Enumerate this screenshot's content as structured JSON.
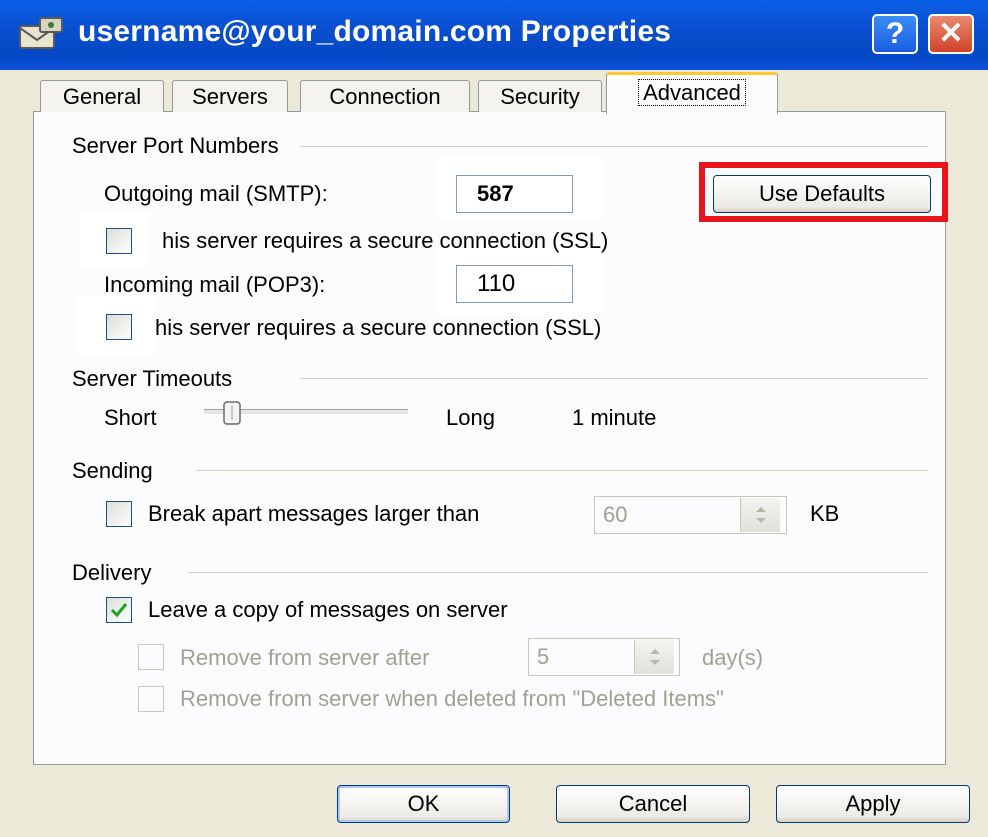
{
  "window": {
    "title": "username@your_domain.com Properties",
    "help_glyph": "?",
    "close_glyph": "✕"
  },
  "tabs": [
    {
      "label": "General"
    },
    {
      "label": "Servers"
    },
    {
      "label": "Connection"
    },
    {
      "label": "Security"
    },
    {
      "label": "Advanced",
      "active": true
    }
  ],
  "ports": {
    "group_label": "Server Port Numbers",
    "smtp_label": "Outgoing mail (SMTP):",
    "smtp_value": "587",
    "defaults_button": "Use Defaults",
    "smtp_ssl_label": "his server requires a secure connection (SSL)",
    "pop3_label": "Incoming mail (POP3):",
    "pop3_value": "110",
    "pop3_ssl_label": "his server requires a secure connection (SSL)"
  },
  "timeouts": {
    "group_label": "Server Timeouts",
    "short_label": "Short",
    "long_label": "Long",
    "value_text": "1 minute"
  },
  "sending": {
    "group_label": "Sending",
    "break_label": "Break apart messages larger than",
    "break_value": "60",
    "unit": "KB"
  },
  "delivery": {
    "group_label": "Delivery",
    "leave_copy_label": "Leave a copy of messages on server",
    "leave_copy_checked": true,
    "remove_after_label": "Remove from server after",
    "remove_after_value": "5",
    "days_label": "day(s)",
    "remove_deleted_label": "Remove from server when deleted from \"Deleted Items\""
  },
  "footer": {
    "ok": "OK",
    "cancel": "Cancel",
    "apply": "Apply"
  },
  "colors": {
    "titlebar": "#0A50D8",
    "highlight": "#E8131B",
    "tab_active_accent": "#FFC83C"
  }
}
